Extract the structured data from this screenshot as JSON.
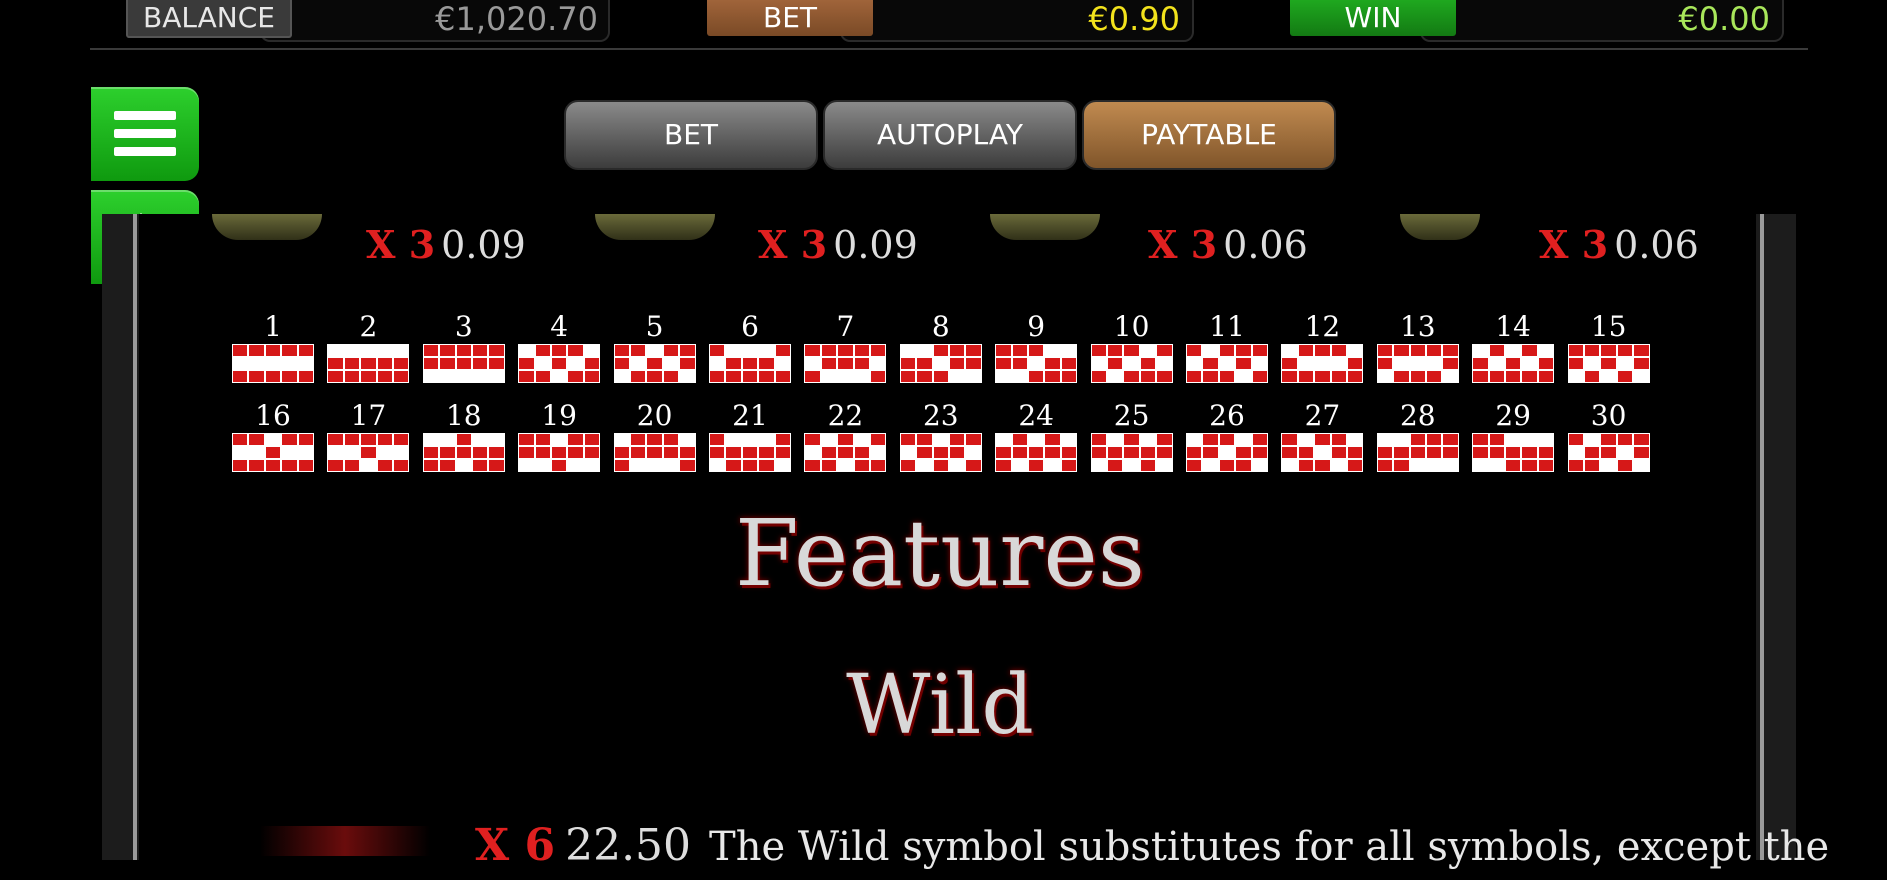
{
  "topbar": {
    "balance_label": "BALANCE",
    "balance_value": "€1,020.70",
    "bet_label": "BET",
    "bet_value": "€0.90",
    "win_label": "WIN",
    "win_value": "€0.00"
  },
  "tabs": [
    {
      "label": "BET"
    },
    {
      "label": "AUTOPLAY"
    },
    {
      "label": "PAYTABLE",
      "active": true
    }
  ],
  "side": {
    "menu_icon": "hamburger-menu-icon",
    "back_icon": "arrow-left-icon"
  },
  "colors": {
    "accent_green": "#1db81d",
    "tab_active": "#a06a35",
    "payout_red": "#e02020",
    "payline_red": "#d61818"
  },
  "payouts": [
    {
      "mult": "X 3",
      "value": "0.09"
    },
    {
      "mult": "X 3",
      "value": "0.09"
    },
    {
      "mult": "X 3",
      "value": "0.06"
    },
    {
      "mult": "X 3",
      "value": "0.06"
    }
  ],
  "paylines": [
    {
      "n": "1",
      "p": [
        1,
        1,
        1,
        1,
        1
      ]
    },
    {
      "n": "2",
      "p": [
        0,
        0,
        0,
        0,
        0
      ]
    },
    {
      "n": "3",
      "p": [
        2,
        2,
        2,
        2,
        2
      ]
    },
    {
      "n": "4",
      "p": [
        0,
        1,
        2,
        1,
        0
      ]
    },
    {
      "n": "5",
      "p": [
        2,
        1,
        0,
        1,
        2
      ]
    },
    {
      "n": "6",
      "p": [
        1,
        0,
        0,
        0,
        1
      ]
    },
    {
      "n": "7",
      "p": [
        1,
        2,
        2,
        2,
        1
      ]
    },
    {
      "n": "8",
      "p": [
        0,
        0,
        1,
        2,
        2
      ]
    },
    {
      "n": "9",
      "p": [
        2,
        2,
        1,
        0,
        0
      ]
    },
    {
      "n": "10",
      "p": [
        1,
        2,
        1,
        0,
        1
      ]
    },
    {
      "n": "11",
      "p": [
        1,
        0,
        1,
        2,
        1
      ]
    },
    {
      "n": "12",
      "p": [
        0,
        1,
        1,
        1,
        0
      ]
    },
    {
      "n": "13",
      "p": [
        2,
        1,
        1,
        1,
        2
      ]
    },
    {
      "n": "14",
      "p": [
        0,
        1,
        0,
        1,
        0
      ]
    },
    {
      "n": "15",
      "p": [
        2,
        1,
        2,
        1,
        2
      ]
    },
    {
      "n": "16",
      "p": [
        1,
        1,
        0,
        1,
        1
      ]
    },
    {
      "n": "17",
      "p": [
        1,
        1,
        2,
        1,
        1
      ]
    },
    {
      "n": "18",
      "p": [
        0,
        0,
        2,
        0,
        0
      ]
    },
    {
      "n": "19",
      "p": [
        2,
        2,
        0,
        2,
        2
      ]
    },
    {
      "n": "20",
      "p": [
        0,
        2,
        2,
        2,
        0
      ]
    },
    {
      "n": "21",
      "p": [
        2,
        0,
        0,
        0,
        2
      ]
    },
    {
      "n": "22",
      "p": [
        1,
        0,
        2,
        0,
        1
      ]
    },
    {
      "n": "23",
      "p": [
        1,
        2,
        0,
        2,
        1
      ]
    },
    {
      "n": "24",
      "p": [
        0,
        2,
        0,
        2,
        0
      ]
    },
    {
      "n": "25",
      "p": [
        2,
        0,
        2,
        0,
        2
      ]
    },
    {
      "n": "26",
      "p": [
        0,
        2,
        1,
        0,
        2
      ]
    },
    {
      "n": "27",
      "p": [
        2,
        0,
        1,
        2,
        0
      ]
    },
    {
      "n": "28",
      "p": [
        0,
        0,
        2,
        2,
        2
      ]
    },
    {
      "n": "29",
      "p": [
        2,
        2,
        0,
        0,
        0
      ]
    },
    {
      "n": "30",
      "p": [
        1,
        0,
        2,
        1,
        2
      ]
    }
  ],
  "features_title": "Features",
  "wild_title": "Wild",
  "wild_payout": {
    "mult": "X 6",
    "value": "22.50",
    "desc": "The Wild symbol substitutes for all symbols, except the"
  }
}
